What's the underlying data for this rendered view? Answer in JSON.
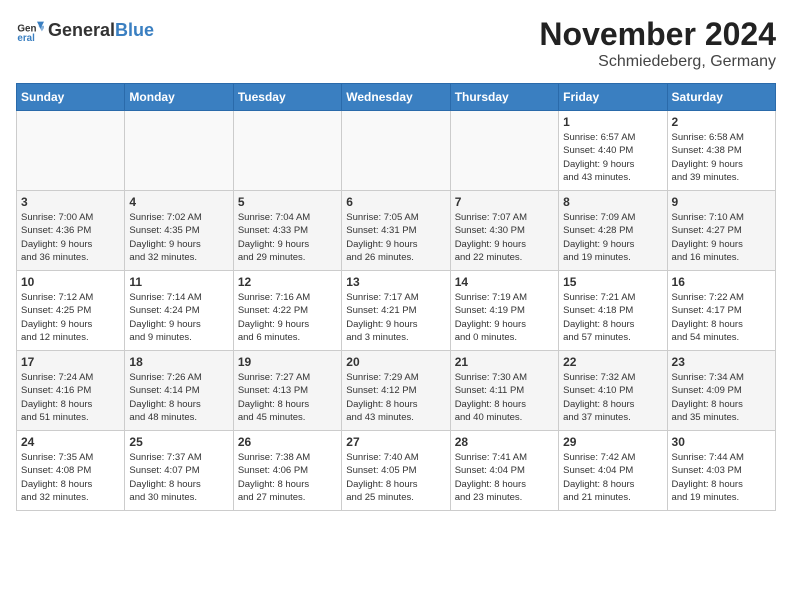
{
  "header": {
    "logo_general": "General",
    "logo_blue": "Blue",
    "month_title": "November 2024",
    "location": "Schmiedeberg, Germany"
  },
  "days_of_week": [
    "Sunday",
    "Monday",
    "Tuesday",
    "Wednesday",
    "Thursday",
    "Friday",
    "Saturday"
  ],
  "weeks": [
    [
      {
        "day": "",
        "info": ""
      },
      {
        "day": "",
        "info": ""
      },
      {
        "day": "",
        "info": ""
      },
      {
        "day": "",
        "info": ""
      },
      {
        "day": "",
        "info": ""
      },
      {
        "day": "1",
        "info": "Sunrise: 6:57 AM\nSunset: 4:40 PM\nDaylight: 9 hours\nand 43 minutes."
      },
      {
        "day": "2",
        "info": "Sunrise: 6:58 AM\nSunset: 4:38 PM\nDaylight: 9 hours\nand 39 minutes."
      }
    ],
    [
      {
        "day": "3",
        "info": "Sunrise: 7:00 AM\nSunset: 4:36 PM\nDaylight: 9 hours\nand 36 minutes."
      },
      {
        "day": "4",
        "info": "Sunrise: 7:02 AM\nSunset: 4:35 PM\nDaylight: 9 hours\nand 32 minutes."
      },
      {
        "day": "5",
        "info": "Sunrise: 7:04 AM\nSunset: 4:33 PM\nDaylight: 9 hours\nand 29 minutes."
      },
      {
        "day": "6",
        "info": "Sunrise: 7:05 AM\nSunset: 4:31 PM\nDaylight: 9 hours\nand 26 minutes."
      },
      {
        "day": "7",
        "info": "Sunrise: 7:07 AM\nSunset: 4:30 PM\nDaylight: 9 hours\nand 22 minutes."
      },
      {
        "day": "8",
        "info": "Sunrise: 7:09 AM\nSunset: 4:28 PM\nDaylight: 9 hours\nand 19 minutes."
      },
      {
        "day": "9",
        "info": "Sunrise: 7:10 AM\nSunset: 4:27 PM\nDaylight: 9 hours\nand 16 minutes."
      }
    ],
    [
      {
        "day": "10",
        "info": "Sunrise: 7:12 AM\nSunset: 4:25 PM\nDaylight: 9 hours\nand 12 minutes."
      },
      {
        "day": "11",
        "info": "Sunrise: 7:14 AM\nSunset: 4:24 PM\nDaylight: 9 hours\nand 9 minutes."
      },
      {
        "day": "12",
        "info": "Sunrise: 7:16 AM\nSunset: 4:22 PM\nDaylight: 9 hours\nand 6 minutes."
      },
      {
        "day": "13",
        "info": "Sunrise: 7:17 AM\nSunset: 4:21 PM\nDaylight: 9 hours\nand 3 minutes."
      },
      {
        "day": "14",
        "info": "Sunrise: 7:19 AM\nSunset: 4:19 PM\nDaylight: 9 hours\nand 0 minutes."
      },
      {
        "day": "15",
        "info": "Sunrise: 7:21 AM\nSunset: 4:18 PM\nDaylight: 8 hours\nand 57 minutes."
      },
      {
        "day": "16",
        "info": "Sunrise: 7:22 AM\nSunset: 4:17 PM\nDaylight: 8 hours\nand 54 minutes."
      }
    ],
    [
      {
        "day": "17",
        "info": "Sunrise: 7:24 AM\nSunset: 4:16 PM\nDaylight: 8 hours\nand 51 minutes."
      },
      {
        "day": "18",
        "info": "Sunrise: 7:26 AM\nSunset: 4:14 PM\nDaylight: 8 hours\nand 48 minutes."
      },
      {
        "day": "19",
        "info": "Sunrise: 7:27 AM\nSunset: 4:13 PM\nDaylight: 8 hours\nand 45 minutes."
      },
      {
        "day": "20",
        "info": "Sunrise: 7:29 AM\nSunset: 4:12 PM\nDaylight: 8 hours\nand 43 minutes."
      },
      {
        "day": "21",
        "info": "Sunrise: 7:30 AM\nSunset: 4:11 PM\nDaylight: 8 hours\nand 40 minutes."
      },
      {
        "day": "22",
        "info": "Sunrise: 7:32 AM\nSunset: 4:10 PM\nDaylight: 8 hours\nand 37 minutes."
      },
      {
        "day": "23",
        "info": "Sunrise: 7:34 AM\nSunset: 4:09 PM\nDaylight: 8 hours\nand 35 minutes."
      }
    ],
    [
      {
        "day": "24",
        "info": "Sunrise: 7:35 AM\nSunset: 4:08 PM\nDaylight: 8 hours\nand 32 minutes."
      },
      {
        "day": "25",
        "info": "Sunrise: 7:37 AM\nSunset: 4:07 PM\nDaylight: 8 hours\nand 30 minutes."
      },
      {
        "day": "26",
        "info": "Sunrise: 7:38 AM\nSunset: 4:06 PM\nDaylight: 8 hours\nand 27 minutes."
      },
      {
        "day": "27",
        "info": "Sunrise: 7:40 AM\nSunset: 4:05 PM\nDaylight: 8 hours\nand 25 minutes."
      },
      {
        "day": "28",
        "info": "Sunrise: 7:41 AM\nSunset: 4:04 PM\nDaylight: 8 hours\nand 23 minutes."
      },
      {
        "day": "29",
        "info": "Sunrise: 7:42 AM\nSunset: 4:04 PM\nDaylight: 8 hours\nand 21 minutes."
      },
      {
        "day": "30",
        "info": "Sunrise: 7:44 AM\nSunset: 4:03 PM\nDaylight: 8 hours\nand 19 minutes."
      }
    ]
  ]
}
